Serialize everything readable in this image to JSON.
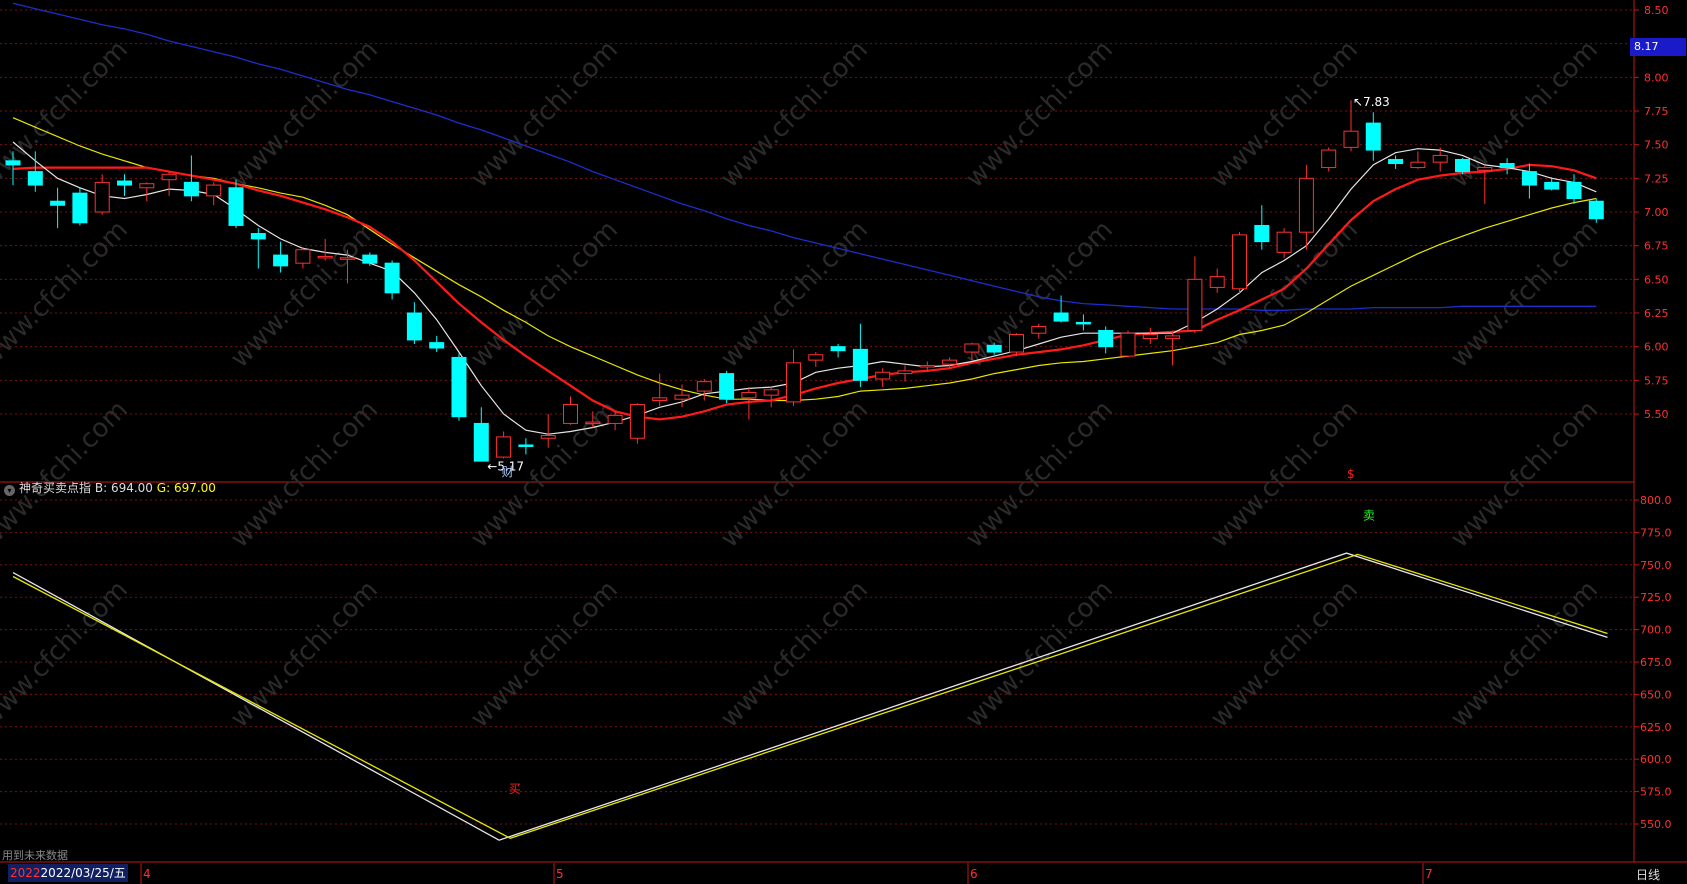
{
  "colors": {
    "background": "#000000",
    "grid": "#7a1010",
    "axis": "#c01818",
    "up": "#ff3030",
    "down": "#00ffff",
    "ma5": "#e6e6e6",
    "ma10": "#ff1a1a",
    "ma20": "#e6e600",
    "ma60": "#1e2ecc",
    "ind_b": "#e8e8e8",
    "ind_g": "#e6e600",
    "buy_label": "#ff2020",
    "sell_label": "#20ff20"
  },
  "header": {
    "indicator_name": "神奇买卖点指",
    "b_label": "B:",
    "b_value": "694.00",
    "g_label": "G:",
    "g_value": "697.00",
    "collapse_icon": "chevron-down-icon"
  },
  "footer": {
    "future_data_warning": "用到未来数据",
    "date_prefix": "2022",
    "date_text": "2022/03/25/五",
    "period_label": "日线"
  },
  "last_price_badge": "8.17",
  "chart_data": [
    {
      "type": "candlestick",
      "pane": "main",
      "ylim": [
        5.17,
        8.55
      ],
      "ytick_labels": [
        "8.50",
        "8.25",
        "8.00",
        "7.75",
        "7.50",
        "7.25",
        "7.00",
        "6.75",
        "6.50",
        "6.25",
        "6.00",
        "5.75",
        "5.50"
      ],
      "x_labels": [
        "4",
        "5",
        "6",
        "7"
      ],
      "candles": [
        {
          "o": 7.38,
          "h": 7.45,
          "l": 7.2,
          "c": 7.35
        },
        {
          "o": 7.3,
          "h": 7.45,
          "l": 7.15,
          "c": 7.2
        },
        {
          "o": 7.08,
          "h": 7.18,
          "l": 6.88,
          "c": 7.05
        },
        {
          "o": 7.14,
          "h": 7.18,
          "l": 6.9,
          "c": 6.92
        },
        {
          "o": 7.0,
          "h": 7.28,
          "l": 6.98,
          "c": 7.22
        },
        {
          "o": 7.23,
          "h": 7.28,
          "l": 7.12,
          "c": 7.2
        },
        {
          "o": 7.18,
          "h": 7.22,
          "l": 7.08,
          "c": 7.21
        },
        {
          "o": 7.24,
          "h": 7.3,
          "l": 7.12,
          "c": 7.28
        },
        {
          "o": 7.22,
          "h": 7.42,
          "l": 7.08,
          "c": 7.12
        },
        {
          "o": 7.12,
          "h": 7.22,
          "l": 7.05,
          "c": 7.2
        },
        {
          "o": 7.18,
          "h": 7.24,
          "l": 6.88,
          "c": 6.9
        },
        {
          "o": 6.84,
          "h": 6.88,
          "l": 6.58,
          "c": 6.8
        },
        {
          "o": 6.68,
          "h": 6.78,
          "l": 6.55,
          "c": 6.6
        },
        {
          "o": 6.62,
          "h": 6.74,
          "l": 6.58,
          "c": 6.72
        },
        {
          "o": 6.66,
          "h": 6.8,
          "l": 6.64,
          "c": 6.67
        },
        {
          "o": 6.65,
          "h": 6.72,
          "l": 6.47,
          "c": 6.66
        },
        {
          "o": 6.68,
          "h": 6.7,
          "l": 6.6,
          "c": 6.62
        },
        {
          "o": 6.62,
          "h": 6.64,
          "l": 6.35,
          "c": 6.4
        },
        {
          "o": 6.25,
          "h": 6.33,
          "l": 6.02,
          "c": 6.05
        },
        {
          "o": 6.03,
          "h": 6.08,
          "l": 5.96,
          "c": 5.99
        },
        {
          "o": 5.92,
          "h": 5.95,
          "l": 5.45,
          "c": 5.48
        },
        {
          "o": 5.43,
          "h": 5.55,
          "l": 5.17,
          "c": 5.15
        },
        {
          "o": 5.18,
          "h": 5.37,
          "l": 5.17,
          "c": 5.33
        },
        {
          "o": 5.27,
          "h": 5.32,
          "l": 5.2,
          "c": 5.26
        },
        {
          "o": 5.32,
          "h": 5.5,
          "l": 5.25,
          "c": 5.34
        },
        {
          "o": 5.43,
          "h": 5.63,
          "l": 5.42,
          "c": 5.57
        },
        {
          "o": 5.43,
          "h": 5.52,
          "l": 5.4,
          "c": 5.44
        },
        {
          "o": 5.43,
          "h": 5.52,
          "l": 5.38,
          "c": 5.49
        },
        {
          "o": 5.32,
          "h": 5.58,
          "l": 5.28,
          "c": 5.57
        },
        {
          "o": 5.6,
          "h": 5.8,
          "l": 5.56,
          "c": 5.62
        },
        {
          "o": 5.61,
          "h": 5.72,
          "l": 5.55,
          "c": 5.64
        },
        {
          "o": 5.67,
          "h": 5.76,
          "l": 5.6,
          "c": 5.74
        },
        {
          "o": 5.8,
          "h": 5.82,
          "l": 5.58,
          "c": 5.61
        },
        {
          "o": 5.62,
          "h": 5.7,
          "l": 5.46,
          "c": 5.66
        },
        {
          "o": 5.64,
          "h": 5.7,
          "l": 5.55,
          "c": 5.68
        },
        {
          "o": 5.59,
          "h": 5.98,
          "l": 5.56,
          "c": 5.88
        },
        {
          "o": 5.9,
          "h": 5.96,
          "l": 5.85,
          "c": 5.94
        },
        {
          "o": 6.0,
          "h": 6.02,
          "l": 5.92,
          "c": 5.97
        },
        {
          "o": 5.98,
          "h": 6.17,
          "l": 5.7,
          "c": 5.75
        },
        {
          "o": 5.76,
          "h": 5.84,
          "l": 5.7,
          "c": 5.81
        },
        {
          "o": 5.8,
          "h": 5.86,
          "l": 5.74,
          "c": 5.82
        },
        {
          "o": 5.85,
          "h": 5.89,
          "l": 5.82,
          "c": 5.86
        },
        {
          "o": 5.87,
          "h": 5.92,
          "l": 5.84,
          "c": 5.9
        },
        {
          "o": 5.96,
          "h": 6.03,
          "l": 5.9,
          "c": 6.02
        },
        {
          "o": 6.01,
          "h": 6.03,
          "l": 5.94,
          "c": 5.96
        },
        {
          "o": 5.96,
          "h": 6.1,
          "l": 5.93,
          "c": 6.09
        },
        {
          "o": 6.1,
          "h": 6.17,
          "l": 6.06,
          "c": 6.15
        },
        {
          "o": 6.25,
          "h": 6.38,
          "l": 6.18,
          "c": 6.19
        },
        {
          "o": 6.18,
          "h": 6.24,
          "l": 6.12,
          "c": 6.17
        },
        {
          "o": 6.12,
          "h": 6.15,
          "l": 5.95,
          "c": 6.0
        },
        {
          "o": 5.93,
          "h": 6.12,
          "l": 5.92,
          "c": 6.1
        },
        {
          "o": 6.06,
          "h": 6.14,
          "l": 6.02,
          "c": 6.09
        },
        {
          "o": 6.06,
          "h": 6.12,
          "l": 5.86,
          "c": 6.08
        },
        {
          "o": 6.12,
          "h": 6.67,
          "l": 6.1,
          "c": 6.5
        },
        {
          "o": 6.44,
          "h": 6.58,
          "l": 6.4,
          "c": 6.52
        },
        {
          "o": 6.43,
          "h": 6.85,
          "l": 6.4,
          "c": 6.83
        },
        {
          "o": 6.9,
          "h": 7.05,
          "l": 6.72,
          "c": 6.78
        },
        {
          "o": 6.7,
          "h": 6.88,
          "l": 6.66,
          "c": 6.85
        },
        {
          "o": 6.85,
          "h": 7.35,
          "l": 6.72,
          "c": 7.25
        },
        {
          "o": 7.33,
          "h": 7.48,
          "l": 7.3,
          "c": 7.46
        },
        {
          "o": 7.48,
          "h": 7.83,
          "l": 7.45,
          "c": 7.6
        },
        {
          "o": 7.66,
          "h": 7.74,
          "l": 7.38,
          "c": 7.46
        },
        {
          "o": 7.39,
          "h": 7.42,
          "l": 7.32,
          "c": 7.36
        },
        {
          "o": 7.33,
          "h": 7.45,
          "l": 7.32,
          "c": 7.37
        },
        {
          "o": 7.37,
          "h": 7.48,
          "l": 7.3,
          "c": 7.42
        },
        {
          "o": 7.39,
          "h": 7.4,
          "l": 7.28,
          "c": 7.3
        },
        {
          "o": 7.31,
          "h": 7.35,
          "l": 7.06,
          "c": 7.33
        },
        {
          "o": 7.36,
          "h": 7.4,
          "l": 7.28,
          "c": 7.33
        },
        {
          "o": 7.3,
          "h": 7.36,
          "l": 7.1,
          "c": 7.2
        },
        {
          "o": 7.22,
          "h": 7.26,
          "l": 7.16,
          "c": 7.17
        },
        {
          "o": 7.22,
          "h": 7.28,
          "l": 7.06,
          "c": 7.1
        },
        {
          "o": 7.08,
          "h": 7.1,
          "l": 6.92,
          "c": 6.95
        }
      ],
      "moving_averages": {
        "ma5": [
          7.52,
          7.38,
          7.25,
          7.18,
          7.12,
          7.1,
          7.13,
          7.17,
          7.16,
          7.13,
          7.02,
          6.9,
          6.8,
          6.73,
          6.7,
          6.68,
          6.62,
          6.56,
          6.4,
          6.2,
          5.96,
          5.71,
          5.5,
          5.38,
          5.35,
          5.37,
          5.4,
          5.44,
          5.49,
          5.55,
          5.59,
          5.65,
          5.67,
          5.69,
          5.7,
          5.73,
          5.81,
          5.84,
          5.86,
          5.89,
          5.87,
          5.85,
          5.86,
          5.89,
          5.93,
          5.97,
          6.02,
          6.07,
          6.1,
          6.1,
          6.1,
          6.1,
          6.1,
          6.18,
          6.28,
          6.4,
          6.55,
          6.64,
          6.75,
          6.95,
          7.17,
          7.35,
          7.44,
          7.47,
          7.46,
          7.42,
          7.35,
          7.33,
          7.3,
          7.25,
          7.22,
          7.15
        ],
        "ma10": [
          7.32,
          7.33,
          7.33,
          7.33,
          7.33,
          7.33,
          7.33,
          7.3,
          7.27,
          7.24,
          7.21,
          7.16,
          7.12,
          7.07,
          7.02,
          6.96,
          6.89,
          6.78,
          6.64,
          6.48,
          6.32,
          6.18,
          6.05,
          5.93,
          5.82,
          5.71,
          5.6,
          5.52,
          5.48,
          5.46,
          5.48,
          5.52,
          5.57,
          5.59,
          5.6,
          5.64,
          5.69,
          5.73,
          5.76,
          5.79,
          5.81,
          5.82,
          5.84,
          5.88,
          5.91,
          5.94,
          5.96,
          5.98,
          6.01,
          6.05,
          6.09,
          6.1,
          6.11,
          6.12,
          6.2,
          6.27,
          6.35,
          6.43,
          6.58,
          6.76,
          6.94,
          7.08,
          7.17,
          7.24,
          7.27,
          7.29,
          7.3,
          7.32,
          7.35,
          7.34,
          7.31,
          7.25
        ],
        "ma20": [
          7.7,
          7.63,
          7.56,
          7.49,
          7.43,
          7.38,
          7.33,
          7.3,
          7.27,
          7.25,
          7.21,
          7.18,
          7.14,
          7.11,
          7.05,
          6.98,
          6.87,
          6.76,
          6.66,
          6.56,
          6.46,
          6.37,
          6.27,
          6.18,
          6.08,
          6.0,
          5.93,
          5.86,
          5.79,
          5.73,
          5.68,
          5.64,
          5.61,
          5.61,
          5.6,
          5.6,
          5.61,
          5.63,
          5.67,
          5.68,
          5.69,
          5.71,
          5.73,
          5.76,
          5.8,
          5.83,
          5.86,
          5.88,
          5.89,
          5.91,
          5.93,
          5.95,
          5.97,
          6.0,
          6.03,
          6.09,
          6.12,
          6.16,
          6.25,
          6.35,
          6.45,
          6.53,
          6.61,
          6.69,
          6.76,
          6.82,
          6.88,
          6.93,
          6.98,
          7.03,
          7.07,
          7.1
        ],
        "ma60": [
          8.55,
          8.51,
          8.47,
          8.43,
          8.39,
          8.36,
          8.32,
          8.27,
          8.23,
          8.19,
          8.15,
          8.1,
          8.06,
          8.01,
          7.96,
          7.91,
          7.87,
          7.82,
          7.77,
          7.72,
          7.66,
          7.61,
          7.55,
          7.49,
          7.43,
          7.37,
          7.3,
          7.24,
          7.18,
          7.12,
          7.06,
          7.01,
          6.95,
          6.9,
          6.86,
          6.81,
          6.77,
          6.73,
          6.69,
          6.65,
          6.61,
          6.57,
          6.53,
          6.49,
          6.45,
          6.41,
          6.37,
          6.34,
          6.32,
          6.31,
          6.3,
          6.29,
          6.28,
          6.28,
          6.28,
          6.28,
          6.27,
          6.27,
          6.28,
          6.28,
          6.28,
          6.29,
          6.29,
          6.29,
          6.29,
          6.3,
          6.3,
          6.3,
          6.3,
          6.3,
          6.3,
          6.3
        ]
      },
      "annotations": [
        {
          "text": "7.83",
          "arrow": "↖"
        },
        {
          "text": "5.17",
          "arrow": "←"
        },
        {
          "text": "财",
          "color": "#aaccff"
        },
        {
          "text": "$",
          "color": "#ff2020"
        }
      ]
    },
    {
      "type": "line",
      "pane": "indicator",
      "ylim": [
        536,
        811
      ],
      "ytick_labels": [
        "800.0",
        "775.0",
        "750.0",
        "725.0",
        "700.0",
        "675.0",
        "650.0",
        "625.0",
        "600.0",
        "575.0",
        "550.0"
      ],
      "series": [
        {
          "name": "B",
          "x": [
            0,
            21.8,
            59.8,
            71.5
          ],
          "values": [
            744.0,
            537.5,
            759.0,
            694.0
          ]
        },
        {
          "name": "G",
          "x": [
            0,
            22.3,
            60.3,
            71.5
          ],
          "values": [
            741.0,
            539.0,
            758.0,
            697.0
          ]
        }
      ],
      "markers": [
        {
          "text": "买",
          "kind": "buy",
          "x": 22.5,
          "y": 574
        },
        {
          "text": "卖",
          "kind": "sell",
          "x": 60.8,
          "y": 785
        }
      ]
    }
  ]
}
